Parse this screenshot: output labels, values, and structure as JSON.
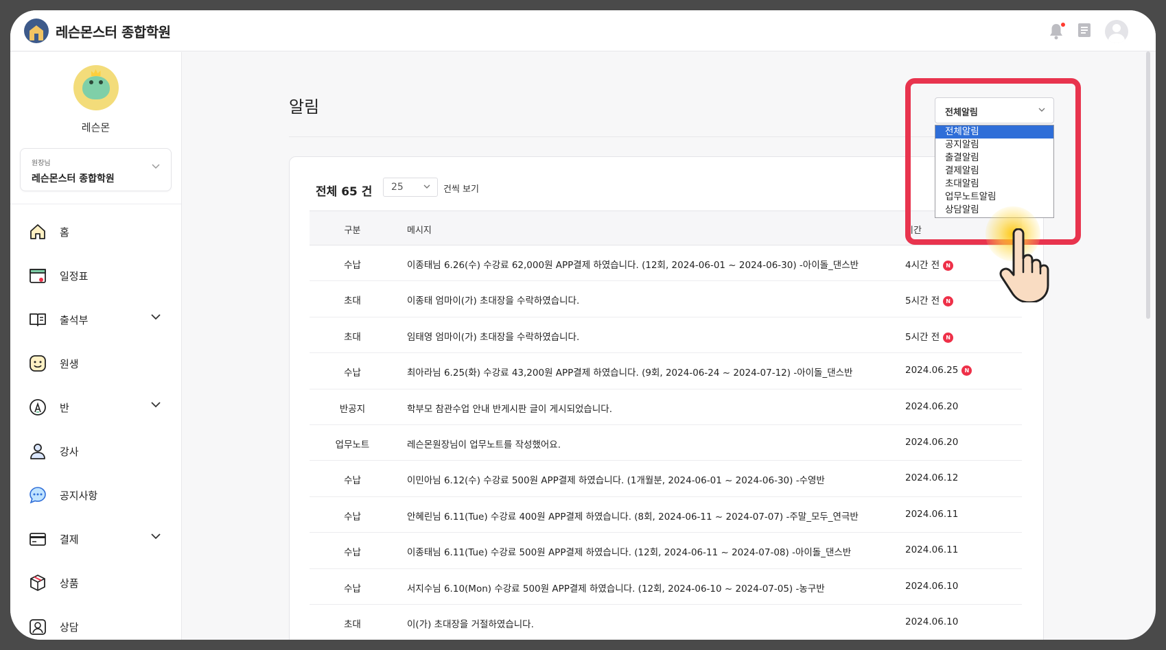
{
  "app": {
    "brand_name": "레슨몬스터 종합학원",
    "notification_dot_color": "#ff3b30"
  },
  "sidebar": {
    "user_name": "레슨몬",
    "school_role": "원장님",
    "school_name": "레슨몬스터 종합학원",
    "items": [
      {
        "label": "홈",
        "icon": "home-icon",
        "expandable": false
      },
      {
        "label": "일정표",
        "icon": "calendar-icon",
        "expandable": false
      },
      {
        "label": "출석부",
        "icon": "book-icon",
        "expandable": true
      },
      {
        "label": "원생",
        "icon": "smile-icon",
        "expandable": false
      },
      {
        "label": "반",
        "icon": "class-icon",
        "expandable": true
      },
      {
        "label": "강사",
        "icon": "person-icon",
        "expandable": false
      },
      {
        "label": "공지사항",
        "icon": "chat-icon",
        "expandable": false
      },
      {
        "label": "결제",
        "icon": "card-icon",
        "expandable": true
      },
      {
        "label": "상품",
        "icon": "box-icon",
        "expandable": false
      },
      {
        "label": "상담",
        "icon": "consult-icon",
        "expandable": false
      }
    ]
  },
  "page": {
    "title": "알림",
    "total_text": "전체 65 건",
    "page_size": "25",
    "page_size_suffix": "건씩 보기"
  },
  "filter": {
    "selected": "전체알림",
    "options": [
      "전체알림",
      "공지알림",
      "출결알림",
      "결제알림",
      "초대알림",
      "업무노트알림",
      "상담알림"
    ],
    "selected_index": 0
  },
  "table": {
    "headers": {
      "type": "구분",
      "message": "메시지",
      "time": "시간"
    },
    "rows": [
      {
        "type": "수납",
        "message": "이종태님 6.26(수) 수강료 62,000원 APP결제 하였습니다. (12회, 2024-06-01 ~ 2024-06-30) -아이돌_댄스반",
        "time": "4시간 전",
        "new": true
      },
      {
        "type": "초대",
        "message": "이종태 엄마이(가) 초대장을 수락하였습니다.",
        "time": "5시간 전",
        "new": true
      },
      {
        "type": "초대",
        "message": "임태영 엄마이(가) 초대장을 수락하였습니다.",
        "time": "5시간 전",
        "new": true
      },
      {
        "type": "수납",
        "message": "최아라님 6.25(화) 수강료 43,200원 APP결제 하였습니다. (9회, 2024-06-24 ~ 2024-07-12) -아이돌_댄스반",
        "time": "2024.06.25",
        "new": true
      },
      {
        "type": "반공지",
        "message": "학부모 참관수업 안내 반게시판 글이 게시되었습니다.",
        "time": "2024.06.20",
        "new": false
      },
      {
        "type": "업무노트",
        "message": "레슨몬원장님이 업무노트를 작성했어요.",
        "time": "2024.06.20",
        "new": false
      },
      {
        "type": "수납",
        "message": "이민아님 6.12(수) 수강료 500원 APP결제 하였습니다. (1개월분, 2024-06-01 ~ 2024-06-30) -수영반",
        "time": "2024.06.12",
        "new": false
      },
      {
        "type": "수납",
        "message": "안혜린님 6.11(Tue) 수강료 400원 APP결제 하였습니다. (8회, 2024-06-11 ~ 2024-07-07) -주말_모두_연극반",
        "time": "2024.06.11",
        "new": false
      },
      {
        "type": "수납",
        "message": "이종태님 6.11(Tue) 수강료 500원 APP결제 하였습니다. (12회, 2024-06-11 ~ 2024-07-08) -아이돌_댄스반",
        "time": "2024.06.11",
        "new": false
      },
      {
        "type": "수납",
        "message": "서지수님 6.10(Mon) 수강료 500원 APP결제 하였습니다. (12회, 2024-06-10 ~ 2024-07-05) -농구반",
        "time": "2024.06.10",
        "new": false
      },
      {
        "type": "초대",
        "message": "이(가) 초대장을 거절하였습니다.",
        "time": "2024.06.10",
        "new": false
      }
    ],
    "new_badge_label": "N",
    "new_badge_color": "#ee3048"
  },
  "highlight_color": "#e8344e"
}
